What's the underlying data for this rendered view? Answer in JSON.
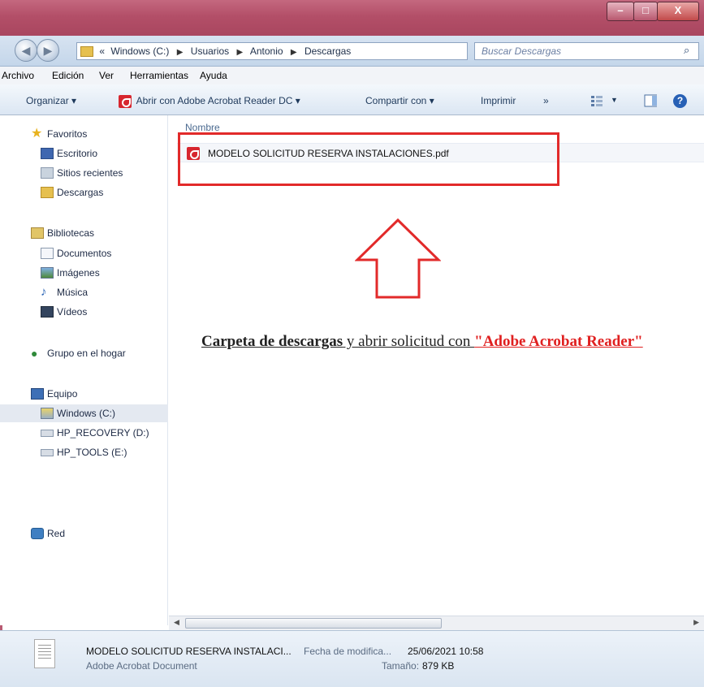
{
  "address": {
    "overflow": "«",
    "crumbs": [
      "Windows (C:)",
      "Usuarios",
      "Antonio",
      "Descargas"
    ],
    "search_placeholder": "Buscar Descargas"
  },
  "menu": [
    "Archivo",
    "Edición",
    "Ver",
    "Herramientas",
    "Ayuda"
  ],
  "toolbar": {
    "organize": "Organizar ▾",
    "open_with": "Abrir con Adobe Acrobat Reader DC ▾",
    "share": "Compartir con ▾",
    "print": "Imprimir",
    "more": "»"
  },
  "sidebar": {
    "favorites": "Favoritos",
    "desktop": "Escritorio",
    "recent": "Sitios recientes",
    "downloads": "Descargas",
    "libraries": "Bibliotecas",
    "documents": "Documentos",
    "pictures": "Imágenes",
    "music": "Música",
    "videos": "Vídeos",
    "homegroup": "Grupo en el hogar",
    "computer": "Equipo",
    "drive_c": "Windows (C:)",
    "drive_d": "HP_RECOVERY (D:)",
    "drive_e": "HP_TOOLS (E:)",
    "network": "Red"
  },
  "main": {
    "column_name": "Nombre",
    "file_name": "MODELO SOLICITUD RESERVA INSTALACIONES.pdf"
  },
  "annotation": {
    "part1": "Carpeta de descargas",
    "part2": " y abrir solicitud con ",
    "part3": "\"Adobe Acrobat Reader\""
  },
  "details": {
    "name": "MODELO SOLICITUD RESERVA INSTALACI...",
    "type": "Adobe Acrobat Document",
    "modified_label": "Fecha de modifica...",
    "modified_value": "25/06/2021 10:58",
    "size_label": "Tamaño:",
    "size_value": "879 KB"
  },
  "colors": {
    "titlebar": "#b34f68",
    "highlight_box": "#e22a2a",
    "annotation_red": "#e02020"
  }
}
